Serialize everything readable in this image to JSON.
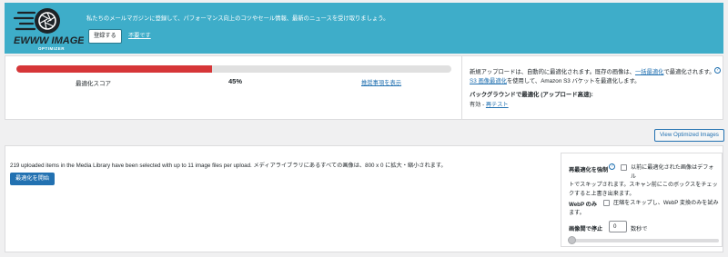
{
  "banner": {
    "logo_brand": "EWWW IMAGE",
    "logo_sub": "OPTIMIZER",
    "message": "私たちのメールマガジンに登録して、パフォーマンス向上のコツやセール情報、最新のニュースを受け取りましょう。",
    "register_label": "登録する",
    "no_need_label": "不要です",
    "colors": {
      "background": "#3eadc9",
      "text": "#ffffff"
    }
  },
  "score": {
    "label": "最適化スコア",
    "value": "45%",
    "progress_fraction": 0.45,
    "details_link": "推奨事項を表示",
    "colors": {
      "fill": "#d63638",
      "track": "#e0e0e0"
    }
  },
  "info": {
    "line1_pre": "新規アップロードは、自動的に最適化されます。既存の画像は、",
    "bulk_link": "一括最適化",
    "line1_post": "で最適化されます。",
    "s3_link": "S3 画像最適化",
    "line2_post": "を使用して、Amazon S3 バケットを最適化します。",
    "help_icon": "question-circle-icon",
    "background_title": "バックグラウンドで最適化 (アップロード高速):",
    "background_status": "有効",
    "separator": " - ",
    "retest_link": "再テスト"
  },
  "view_button": "View Optimized Images",
  "bulk": {
    "uploaded_text": "219 uploaded items in the Media Library have been selected with up to 11 image files per upload. メディアライブラリにあるすべての画像は、800 x 0 に拡大・縮小されます。",
    "start_button": "最適化を開始",
    "colors": {
      "primary": "#2271b1"
    }
  },
  "options": {
    "reoptimize_title": "再最適化を強制",
    "reoptimize_help_icon": "question-circle-icon",
    "reoptimize_desc": "以前に最適化された画像はデフォル",
    "reoptimize_desc2": "トでスキップされます。スキャン前にこのボックスをチェックすると上書き出来ます。",
    "webp_title": "WebP のみ",
    "webp_desc": "圧縮をスキップし、WebP 変換のみを試み",
    "webp_desc2": "ます。",
    "pause_title": "画像間で停止",
    "pause_value": "0",
    "pause_unit": "数秒で",
    "slider_value": 0
  }
}
